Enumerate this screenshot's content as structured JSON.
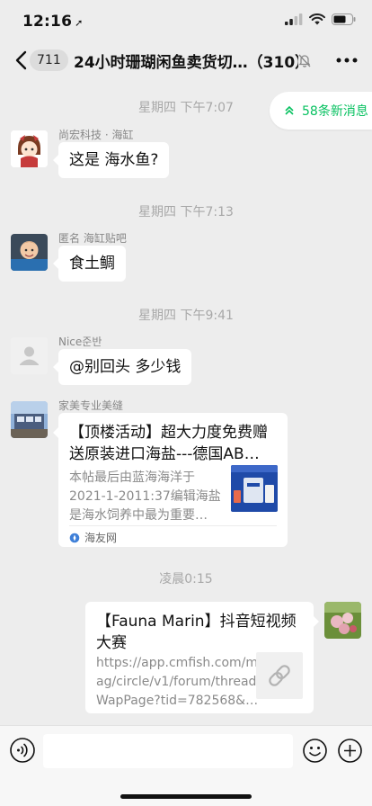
{
  "status_bar": {
    "time": "12:16",
    "location_icon": "location-arrow-icon",
    "signal_icon": "cellular-signal-icon",
    "wifi_icon": "wifi-icon",
    "battery_icon": "battery-icon"
  },
  "nav": {
    "unread_count": "711",
    "title": "24小时珊瑚闲鱼卖货切…（310）",
    "back_icon": "chevron-left-icon",
    "mute_icon": "bell-muted-icon",
    "more_icon": "more-dots-icon"
  },
  "new_messages": {
    "label": "58条新消息",
    "icon": "double-chevron-up-icon",
    "accent": "#07c160"
  },
  "timestamps": [
    "星期四 下午7:07",
    "星期四 下午7:13",
    "星期四 下午9:41",
    "凌晨0:15"
  ],
  "messages": [
    {
      "sender": "尚宏科技 · 海缸",
      "text": "这是 海水鱼?",
      "avatar": "cartoon-girl-avatar"
    },
    {
      "sender": "匿名 海缸贴吧",
      "text": "食土鲷",
      "avatar": "child-photo-avatar"
    },
    {
      "sender": "Nice준반",
      "text": "@别回头 多少钱",
      "avatar": "default-person-avatar"
    }
  ],
  "link_card_1": {
    "sender": "家美专业美缝",
    "title_line1": "【顶楼活动】超大力度免费赠",
    "title_line2": "送原装进口海盐---德国AB…",
    "desc_line1": "本帖最后由蓝海海洋于",
    "desc_line2": "2021-1-2011:37编辑海盐",
    "desc_line3": "是海水饲养中最为重要…",
    "source": "海友网",
    "avatar": "storefront-avatar"
  },
  "link_card_2": {
    "title_line1": "【Fauna Marin】抖音短视频",
    "title_line2": "大赛",
    "url_line1": "https://app.cmfish.com/m",
    "url_line2": "ag/circle/v1/forum/thread",
    "url_line3": "WapPage?tid=782568&…",
    "thumb_icon": "link-chain-icon",
    "avatar": "flower-photo-avatar"
  },
  "input_bar": {
    "placeholder": "",
    "voice_icon": "voice-icon",
    "emoji_icon": "emoji-icon",
    "plus_icon": "plus-icon"
  }
}
